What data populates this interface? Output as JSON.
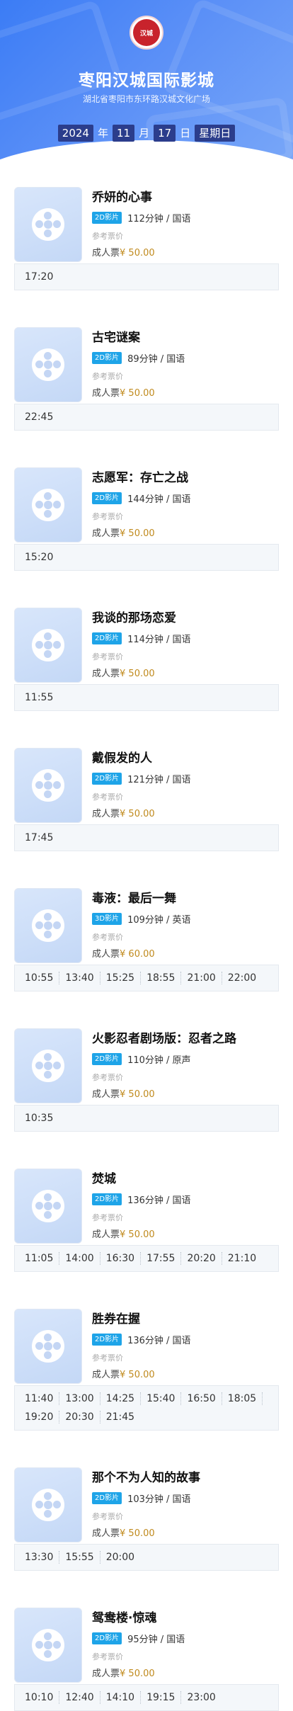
{
  "header": {
    "cinema_name": "枣阳汉城国际影城",
    "address": "湖北省枣阳市东环路汉城文化广场",
    "logo_text": "汉城",
    "date": {
      "year": "2024",
      "year_unit": "年",
      "month": "11",
      "month_unit": "月",
      "day": "17",
      "day_unit": "日",
      "weekday": "星期日"
    }
  },
  "labels": {
    "ref_price": "参考票价",
    "adult_ticket": "成人票"
  },
  "movies": [
    {
      "title": "乔妍的心事",
      "format": "2D影片",
      "duration": "112分钟",
      "language": "国语",
      "price": "¥ 50.00",
      "times": [
        "17:20"
      ]
    },
    {
      "title": "古宅谜案",
      "format": "2D影片",
      "duration": "89分钟",
      "language": "国语",
      "price": "¥ 50.00",
      "times": [
        "22:45"
      ]
    },
    {
      "title": "志愿军：存亡之战",
      "format": "2D影片",
      "duration": "144分钟",
      "language": "国语",
      "price": "¥ 50.00",
      "times": [
        "15:20"
      ]
    },
    {
      "title": "我谈的那场恋爱",
      "format": "2D影片",
      "duration": "114分钟",
      "language": "国语",
      "price": "¥ 50.00",
      "times": [
        "11:55"
      ]
    },
    {
      "title": "戴假发的人",
      "format": "2D影片",
      "duration": "121分钟",
      "language": "国语",
      "price": "¥ 50.00",
      "times": [
        "17:45"
      ]
    },
    {
      "title": "毒液：最后一舞",
      "format": "3D影片",
      "duration": "109分钟",
      "language": "英语",
      "price": "¥ 60.00",
      "times": [
        "10:55",
        "13:40",
        "15:25",
        "18:55",
        "21:00",
        "22:00"
      ]
    },
    {
      "title": "火影忍者剧场版：忍者之路",
      "format": "2D影片",
      "duration": "110分钟",
      "language": "原声",
      "price": "¥ 50.00",
      "times": [
        "10:35"
      ]
    },
    {
      "title": "焚城",
      "format": "2D影片",
      "duration": "136分钟",
      "language": "国语",
      "price": "¥ 50.00",
      "times": [
        "11:05",
        "14:00",
        "16:30",
        "17:55",
        "20:20",
        "21:10"
      ]
    },
    {
      "title": "胜券在握",
      "format": "2D影片",
      "duration": "136分钟",
      "language": "国语",
      "price": "¥ 50.00",
      "times": [
        "11:40",
        "13:00",
        "14:25",
        "15:40",
        "16:50",
        "18:05",
        "19:20",
        "20:30",
        "21:45"
      ]
    },
    {
      "title": "那个不为人知的故事",
      "format": "2D影片",
      "duration": "103分钟",
      "language": "国语",
      "price": "¥ 50.00",
      "times": [
        "13:30",
        "15:55",
        "20:00"
      ]
    },
    {
      "title": "鸳鸯楼·惊魂",
      "format": "2D影片",
      "duration": "95分钟",
      "language": "国语",
      "price": "¥ 50.00",
      "times": [
        "10:10",
        "12:40",
        "14:10",
        "19:15",
        "23:00"
      ]
    }
  ]
}
